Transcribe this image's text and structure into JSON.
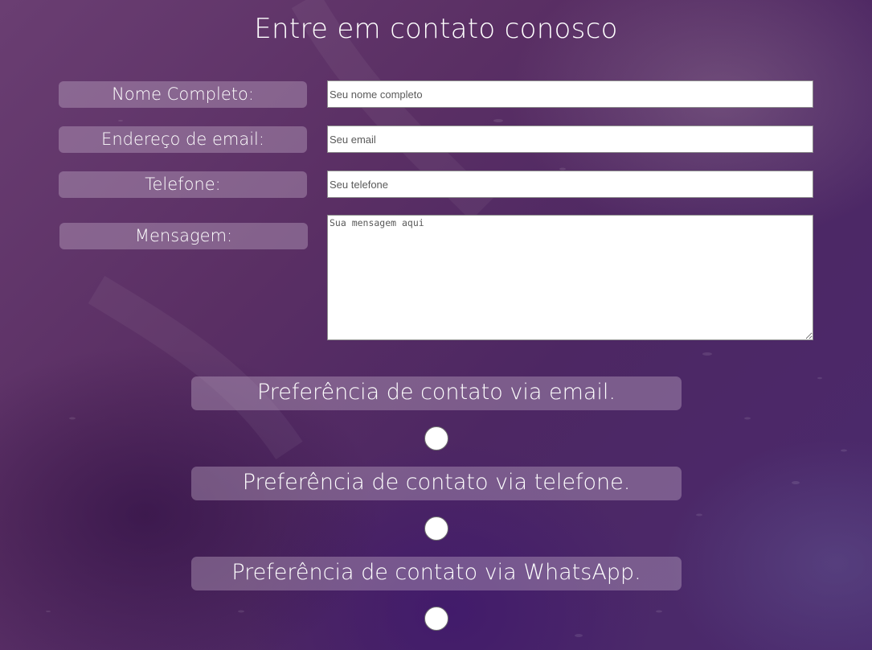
{
  "page": {
    "title": "Entre em contato conosco"
  },
  "form": {
    "fields": [
      {
        "label": "Nome Completo:",
        "placeholder": "Seu nome completo",
        "value": ""
      },
      {
        "label": "Endereço de email:",
        "placeholder": "Seu email",
        "value": ""
      },
      {
        "label": "Telefone:",
        "placeholder": "Seu telefone",
        "value": ""
      }
    ],
    "message": {
      "label": "Mensagem:",
      "placeholder": "Sua mensagem aqui",
      "value": ""
    }
  },
  "preferences": [
    {
      "label": "Preferência de contato via email.",
      "selected": false
    },
    {
      "label": "Preferência de contato via telefone.",
      "selected": false
    },
    {
      "label": "Preferência de contato via WhatsApp.",
      "selected": false
    }
  ],
  "colors": {
    "pill_background": "rgba(200,180,205,0.38)",
    "background_primary": "#5a2f64",
    "text": "#ffffff"
  }
}
